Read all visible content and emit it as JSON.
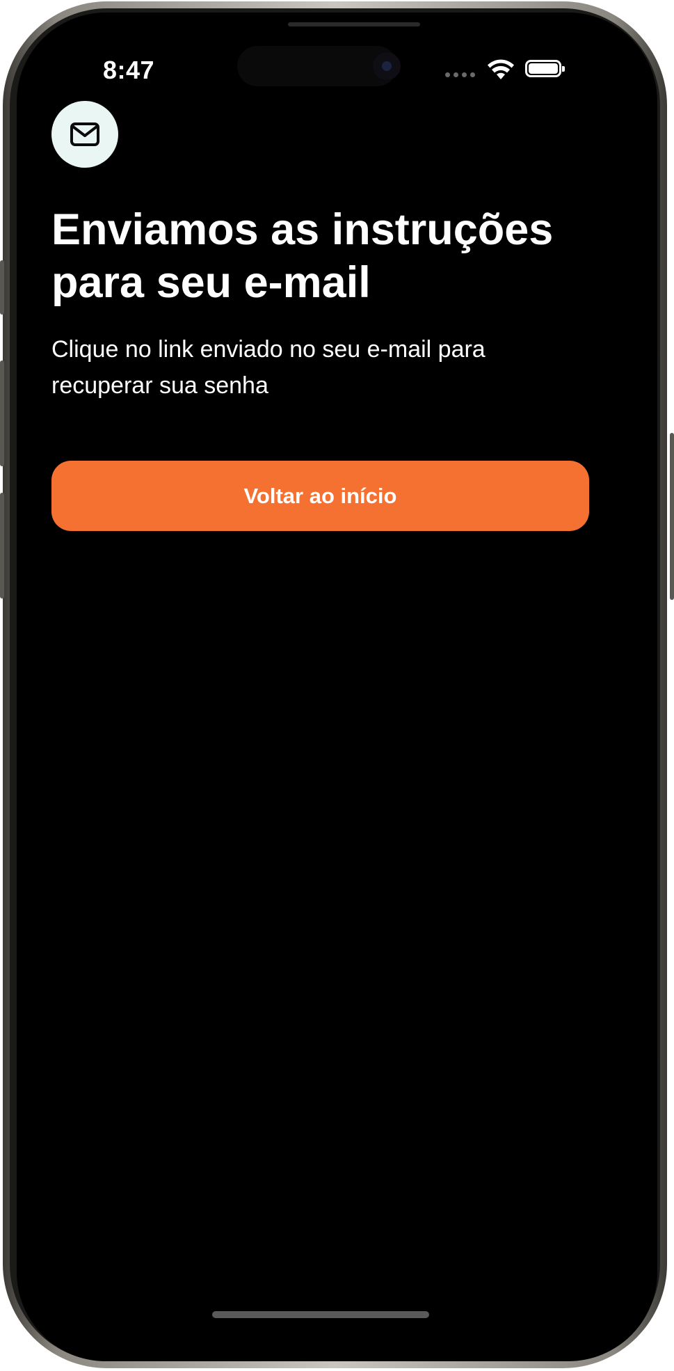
{
  "status_bar": {
    "time": "8:47"
  },
  "header": {
    "icon": "mail-icon",
    "icon_background": "#e9f6f4"
  },
  "content": {
    "title": "Enviamos as instruções para seu e-mail",
    "subtitle": "Clique no link enviado no seu e-mail para recuperar sua senha"
  },
  "actions": {
    "back_home_label": "Voltar ao início",
    "back_home_color": "#f57132"
  },
  "theme": {
    "screen_background": "#000000",
    "text_color": "#ffffff"
  }
}
